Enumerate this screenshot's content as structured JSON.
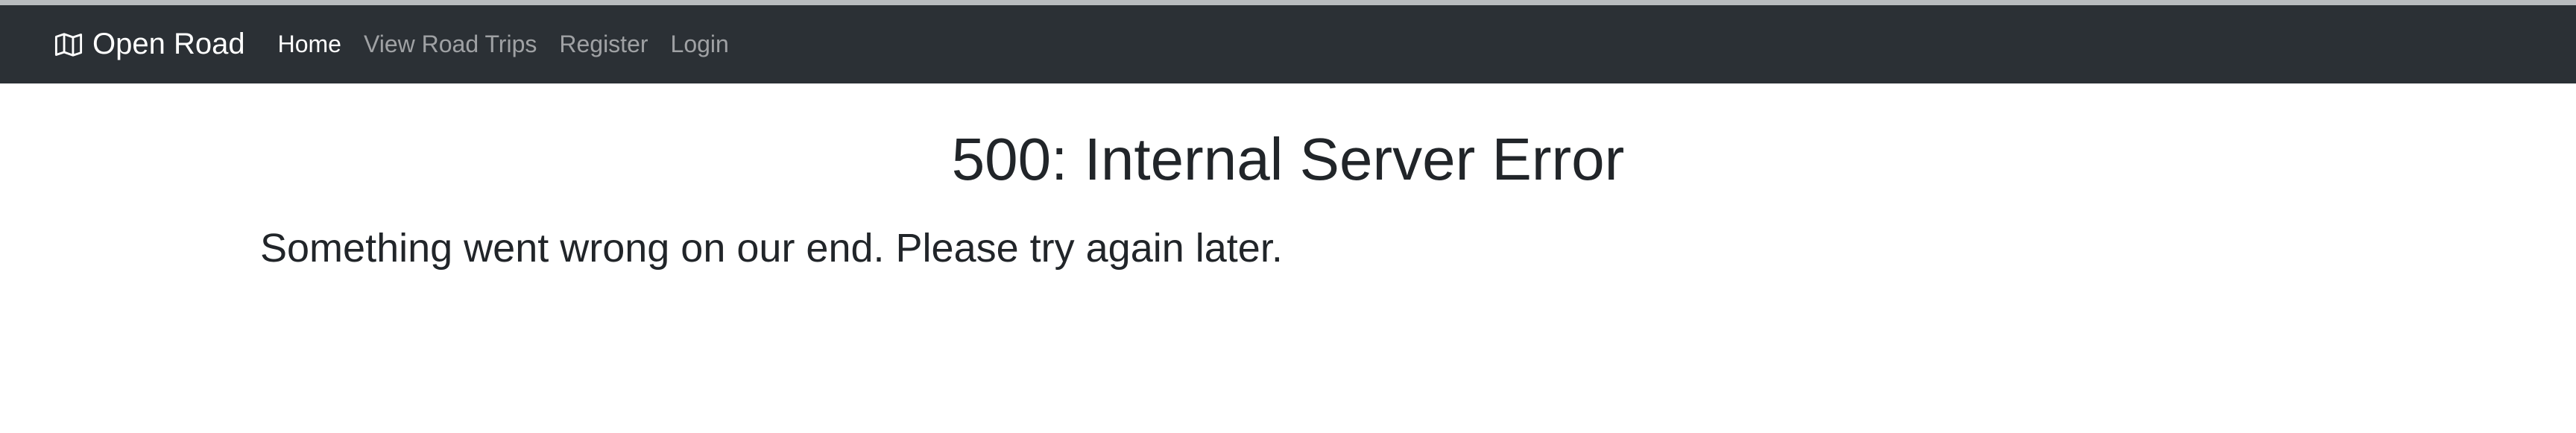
{
  "navbar": {
    "brand_label": "Open Road",
    "brand_icon": "map-icon",
    "links": [
      {
        "label": "Home",
        "active": true
      },
      {
        "label": "View Road Trips",
        "active": false
      },
      {
        "label": "Register",
        "active": false
      },
      {
        "label": "Login",
        "active": false
      }
    ]
  },
  "main": {
    "title": "500: Internal Server Error",
    "message": "Something went wrong on our end. Please try again later."
  },
  "colors": {
    "navbar_bg": "#2b3035",
    "text": "#212529",
    "nav_inactive": "rgba(255,255,255,0.55)"
  }
}
